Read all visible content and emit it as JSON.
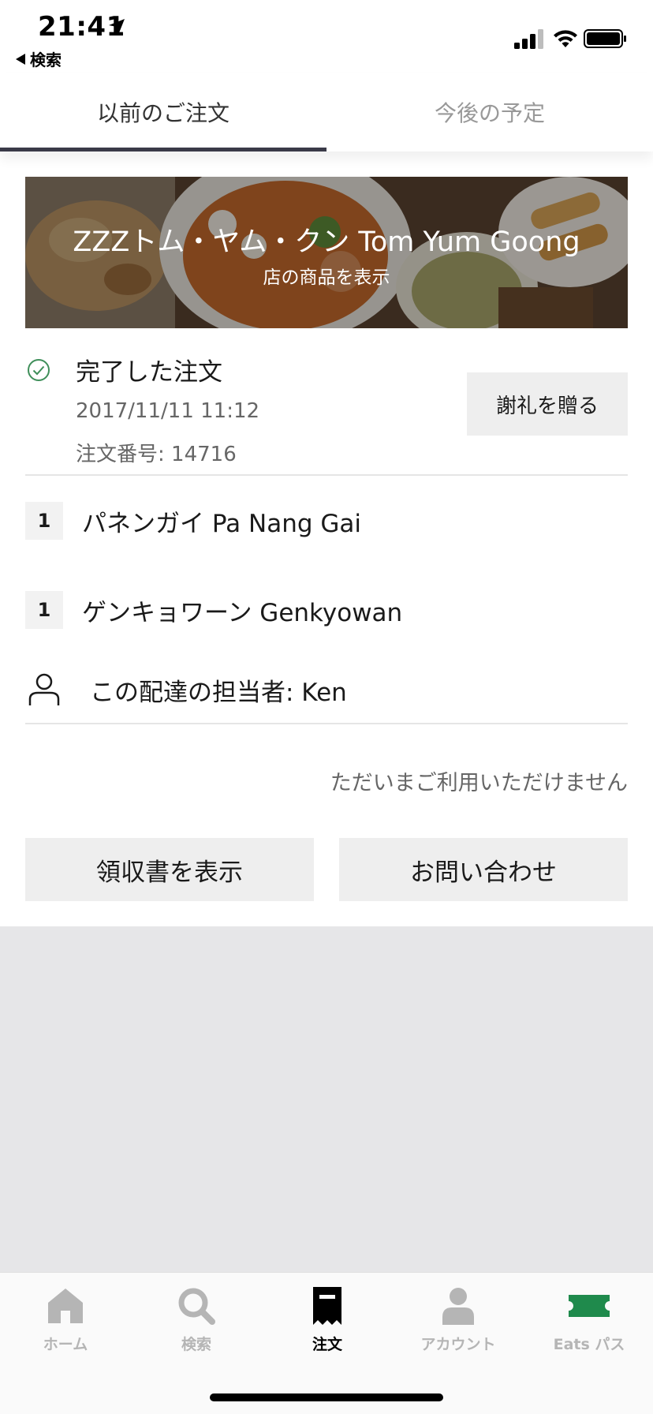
{
  "status_bar": {
    "time": "21:41",
    "back_label": "検索"
  },
  "tabs": [
    {
      "label": "以前のご注文",
      "active": true
    },
    {
      "label": "今後の予定",
      "active": false
    }
  ],
  "restaurant": {
    "name": "ZZZトム・ヤム・クン Tom Yum Goong",
    "view_items_label": "店の商品を表示"
  },
  "order": {
    "status": "完了した注文",
    "date": "2017/11/11 11:12",
    "number": "注文番号: 14716",
    "thanks_button": "謝礼を贈る",
    "items": [
      {
        "qty": "1",
        "name": "パネンガイ Pa Nang Gai"
      },
      {
        "qty": "1",
        "name": "ゲンキョワーン Genkyowan"
      }
    ],
    "courier": "この配達の担当者: Ken",
    "unavailable_text": "ただいまご利用いただけません",
    "receipt_button": "領収書を表示",
    "contact_button": "お問い合わせ"
  },
  "bottom_nav": [
    {
      "label": "ホーム",
      "icon": "home-icon",
      "active": false
    },
    {
      "label": "検索",
      "icon": "search-icon",
      "active": false
    },
    {
      "label": "注文",
      "icon": "receipt-icon",
      "active": true
    },
    {
      "label": "アカウント",
      "icon": "account-icon",
      "active": false
    },
    {
      "label": "Eats パス",
      "icon": "ticket-icon",
      "active": false
    }
  ],
  "colors": {
    "check_green": "#3f8f5a",
    "tab_indicator": "#3a3a48",
    "eats_pass_green": "#1f8a4c",
    "button_bg": "#eeeeee"
  }
}
